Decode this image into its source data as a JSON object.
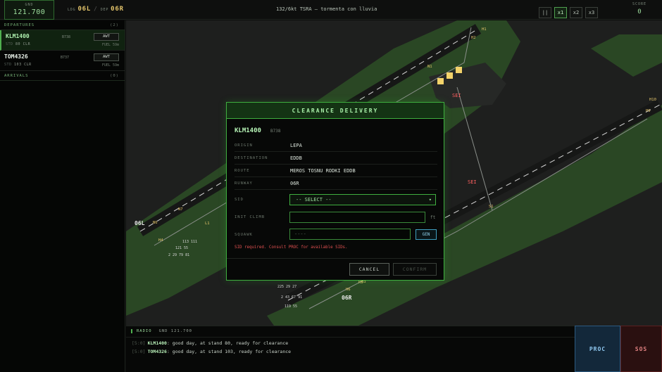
{
  "topbar": {
    "freq_label": "GND",
    "freq_value": "121.700",
    "ldg_label": "LDG",
    "ldg_runway": "06L",
    "dep_label": "DEP",
    "dep_runway": "06R",
    "metar": "132/6kt TSRA — tormenta con lluvia",
    "speed_buttons": [
      "||",
      "x1",
      "x2",
      "x3"
    ],
    "speed_active": "x1",
    "score_label": "SCORE",
    "score_value": "0"
  },
  "departures": {
    "title": "DEPARTURES",
    "count": "(2)",
    "strips": [
      {
        "callsign": "KLM1400",
        "type": "B738",
        "stand_label": "STD",
        "stand": "80",
        "state": "CLR",
        "status": "AWT",
        "fuel": "FUEL 59m"
      },
      {
        "callsign": "TOM4326",
        "type": "B737",
        "stand_label": "STD",
        "stand": "103",
        "state": "CLR",
        "status": "AWT",
        "fuel": "FUEL 59m"
      }
    ]
  },
  "arrivals": {
    "title": "ARRIVALS",
    "count": "(0)"
  },
  "map_labels": {
    "rwy_06l": "06L",
    "rwy_06r": "06R",
    "sei_a": "SEI",
    "sei_b": "SEI",
    "twy": [
      "H1",
      "H2",
      "N1",
      "N7",
      "N6",
      "H10",
      "H9",
      "S1",
      "L1",
      "H6",
      "H5",
      "H4",
      "H3"
    ]
  },
  "dialog": {
    "title": "CLEARANCE DELIVERY",
    "callsign": "KLM1400",
    "type": "B738",
    "rows": [
      {
        "key": "ORIGIN",
        "value": "LEPA"
      },
      {
        "key": "DESTINATION",
        "value": "EDDB"
      },
      {
        "key": "ROUTE",
        "value": "MEROS TOSNU RODKI EDDB"
      },
      {
        "key": "RUNWAY",
        "value": "06R"
      }
    ],
    "sid_label": "SID",
    "sid_value": "-- SELECT --",
    "climb_label": "INIT CLIMB",
    "climb_unit": "ft",
    "squawk_label": "SQUAWK",
    "squawk_placeholder": "----",
    "gen_label": "GEN",
    "error": "SID required. Consult PROC for available SIDs.",
    "cancel": "CANCEL",
    "confirm": "CONFIRM"
  },
  "radio": {
    "title": "RADIO",
    "freq": "GND 121.700",
    "messages": [
      {
        "time": "[5:0]",
        "callsign": "KLM1400",
        "text": ": good day, at stand 80, ready for clearance"
      },
      {
        "time": "[5:0]",
        "callsign": "TOM4326",
        "text": ": good day, at stand 103, ready for clearance"
      }
    ]
  },
  "buttons": {
    "proc": "PROC",
    "sos": "SOS"
  },
  "colors": {
    "accent": "#3fae3f",
    "grass": "#2c4a26",
    "error": "#e05050",
    "gate": "#f3d36a"
  }
}
